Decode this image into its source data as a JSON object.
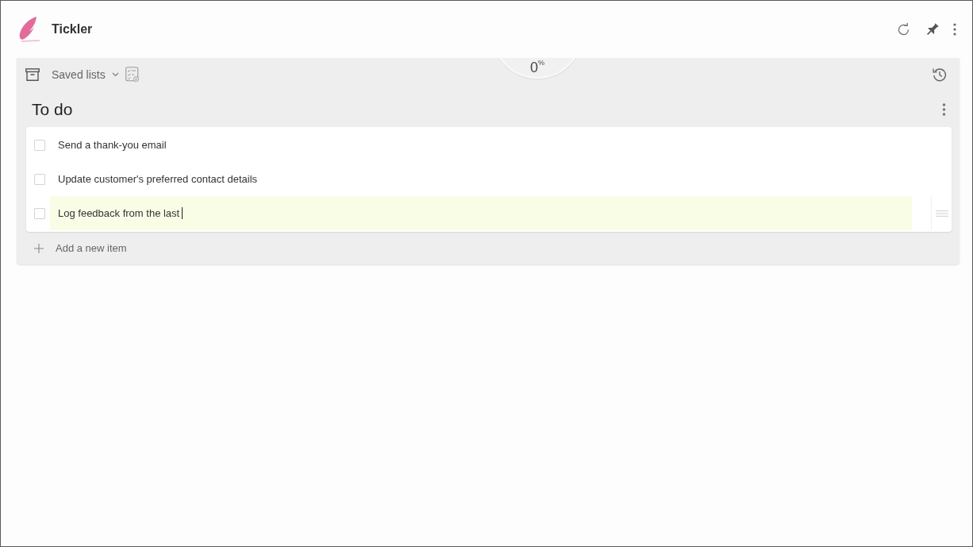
{
  "app": {
    "title": "Tickler"
  },
  "toolbar": {
    "saved_lists": "Saved lists"
  },
  "progress": {
    "reading": "0$^{%}$"
  },
  "list": {
    "title": "To do",
    "items": [
      {
        "text": "Send a thank-you email",
        "checked": false,
        "editing": false
      },
      {
        "text": "Update customer's preferred contact details",
        "checked": false,
        "editing": false
      },
      {
        "text": "Log feedback from the last",
        "checked": false,
        "editing": true
      }
    ],
    "add_item": "Add a new item"
  }
}
